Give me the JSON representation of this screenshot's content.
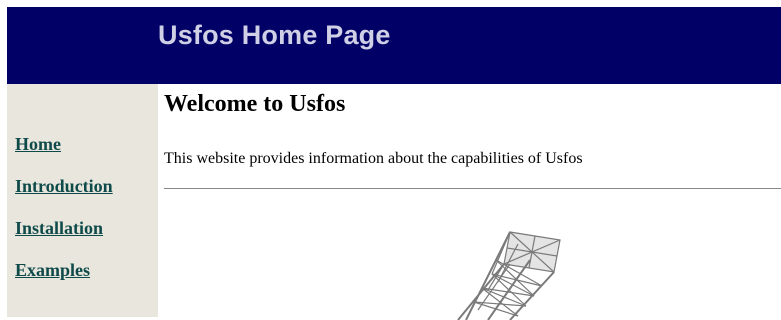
{
  "header": {
    "title": "Usfos Home Page"
  },
  "sidebar": {
    "items": [
      {
        "label": "Home"
      },
      {
        "label": "Introduction"
      },
      {
        "label": "Installation"
      },
      {
        "label": "Examples"
      }
    ]
  },
  "main": {
    "heading": "Welcome to Usfos",
    "intro": "This website provides information about the capabilities of Usfos"
  },
  "colors": {
    "banner": "#000066",
    "banner_text": "#cfcfe6",
    "sidebar_bg": "#e8e6dd",
    "link": "#0f4a4a"
  },
  "image": {
    "icon": "offshore-jacket-structure-image"
  }
}
